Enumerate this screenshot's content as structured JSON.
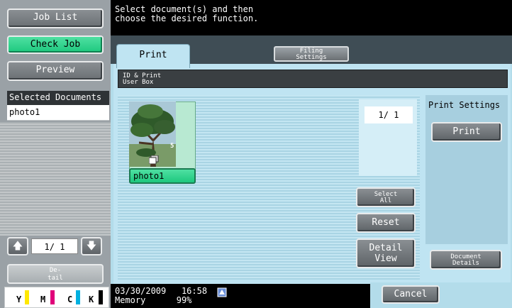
{
  "left_panel": {
    "job_list": "Job List",
    "check_job": "Check Job",
    "preview": "Preview",
    "selected_documents_title": "Selected Documents",
    "selected_documents": [
      "photo1"
    ],
    "pager": "1/ 1",
    "detail_line1": "De-",
    "detail_line2": "tail",
    "toner": [
      {
        "label": "Y",
        "color": "#ffe800"
      },
      {
        "label": "M",
        "color": "#e0007a"
      },
      {
        "label": "C",
        "color": "#00b0e0"
      },
      {
        "label": "K",
        "color": "#000000"
      }
    ]
  },
  "message": {
    "line1": "Select document(s) and then",
    "line2": "choose the desired function."
  },
  "tabs": {
    "print": "Print",
    "filing_line1": "Filing",
    "filing_line2": "Settings"
  },
  "box_bar": {
    "line1": "ID & Print",
    "line2": "User Box"
  },
  "document": {
    "name": "photo1",
    "pages": "5"
  },
  "page_count": "1/  1",
  "buttons": {
    "select_all_line1": "Select",
    "select_all_line2": "All",
    "reset": "Reset",
    "detail_view_line1": "Detail",
    "detail_view_line2": "View",
    "print_settings_title": "Print Settings",
    "print": "Print",
    "doc_details_line1": "Document",
    "doc_details_line2": "Details",
    "cancel": "Cancel"
  },
  "status": {
    "date": "03/30/2009",
    "time": "16:58",
    "memory_label": "Memory",
    "memory_value": "99%"
  }
}
